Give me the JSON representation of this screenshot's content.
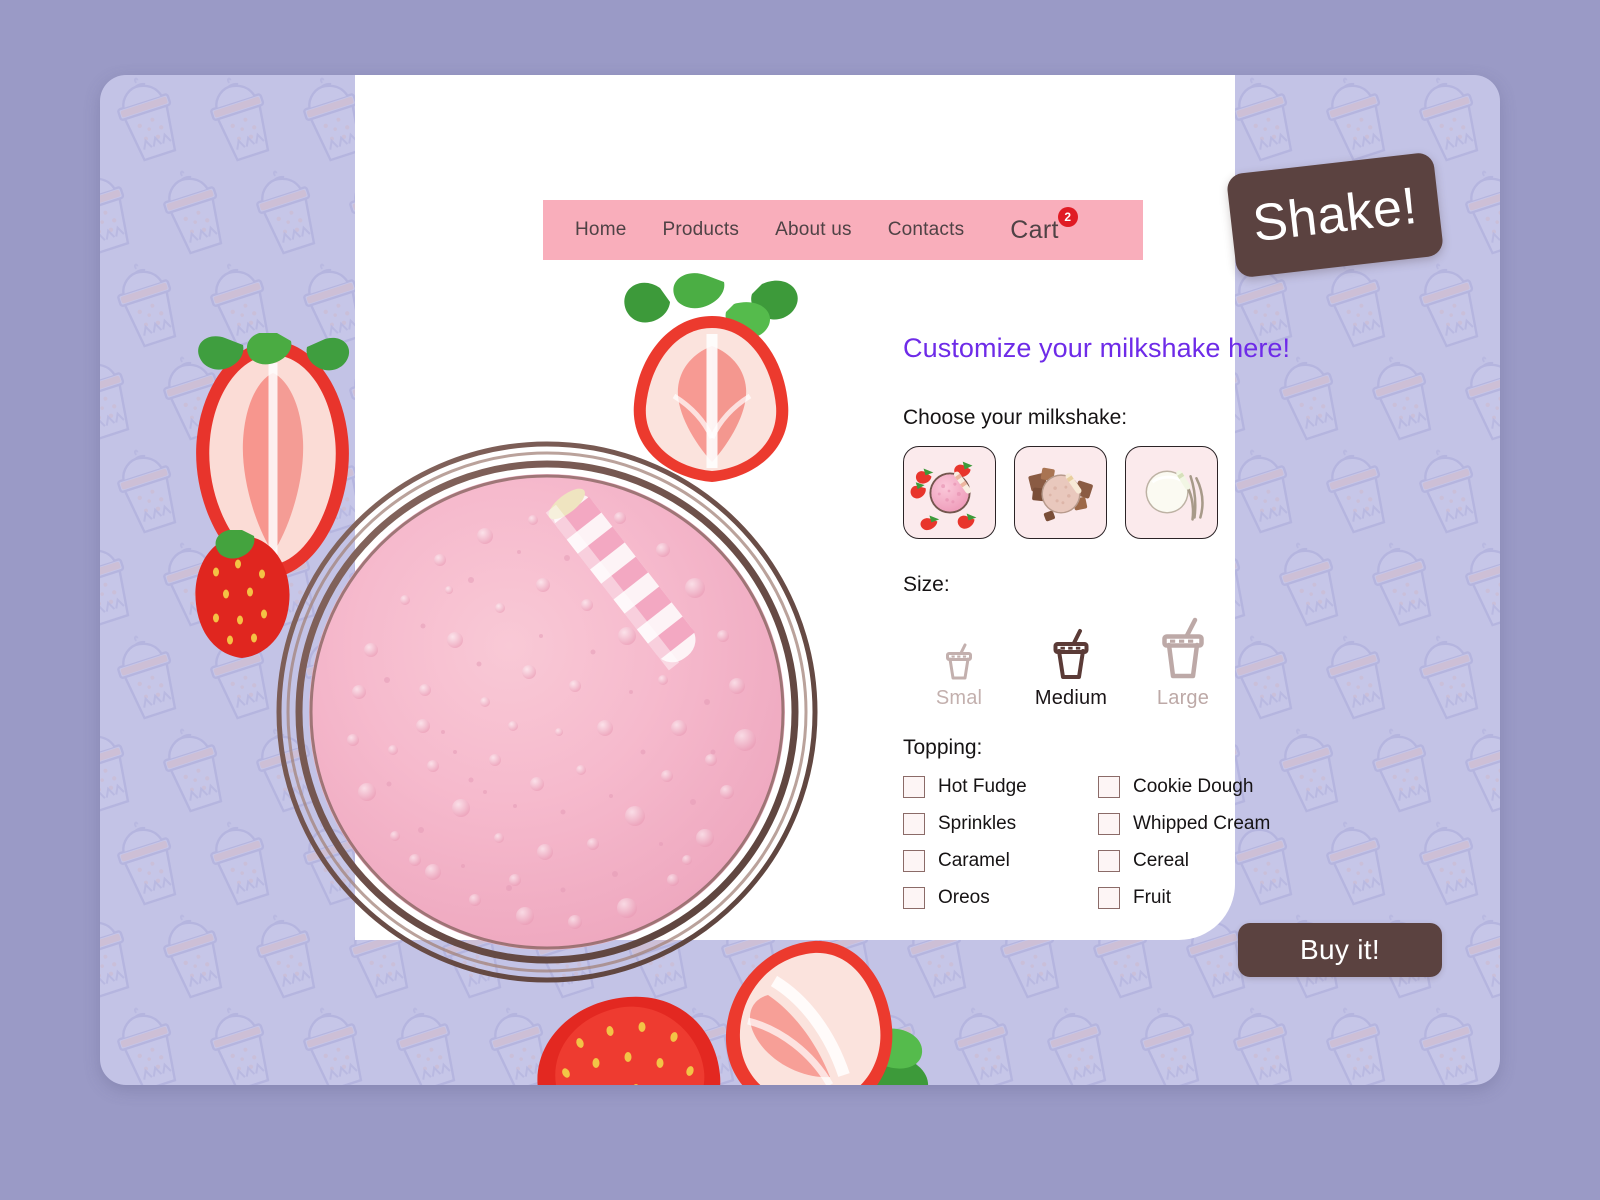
{
  "brand": {
    "logo_text": "Shake!"
  },
  "nav": {
    "links": [
      {
        "label": "Home",
        "name": "nav-link-home"
      },
      {
        "label": "Products",
        "name": "nav-link-products"
      },
      {
        "label": "About us",
        "name": "nav-link-about-us"
      },
      {
        "label": "Contacts",
        "name": "nav-link-contacts"
      }
    ],
    "cart_label": "Cart",
    "cart_count": "2"
  },
  "main": {
    "headline": "Customize your milkshake here!",
    "flavor_label": "Choose your milkshake:",
    "flavors": [
      {
        "name": "strawberry",
        "selected": false
      },
      {
        "name": "chocolate",
        "selected": false
      },
      {
        "name": "vanilla",
        "selected": false
      }
    ],
    "size_label": "Size:",
    "sizes": [
      {
        "label": "Smal",
        "value": "small",
        "selected": false
      },
      {
        "label": "Medium",
        "value": "medium",
        "selected": true
      },
      {
        "label": "Large",
        "value": "large",
        "selected": false
      }
    ],
    "topping_label": "Topping:",
    "toppings": [
      {
        "label": "Hot Fudge",
        "checked": false
      },
      {
        "label": "Cookie Dough",
        "checked": false
      },
      {
        "label": "Sprinkles",
        "checked": false
      },
      {
        "label": "Whipped Cream",
        "checked": false
      },
      {
        "label": "Caramel",
        "checked": false
      },
      {
        "label": "Cereal",
        "checked": false
      },
      {
        "label": "Oreos",
        "checked": false
      },
      {
        "label": "Fruit",
        "checked": false
      }
    ],
    "buy_label": "Buy it!"
  },
  "colors": {
    "frame_outer": "#9a9ac6",
    "panel_inner": "#c3c3e6",
    "card": "#ffffff",
    "navbar_pink": "#f9aebb",
    "headline_purple": "#6e2be8",
    "brand_brown": "#5b4240",
    "badge_red": "#e01b24",
    "shake_pink": "#f0a6bb",
    "checkbox_border": "#8b6b68"
  }
}
